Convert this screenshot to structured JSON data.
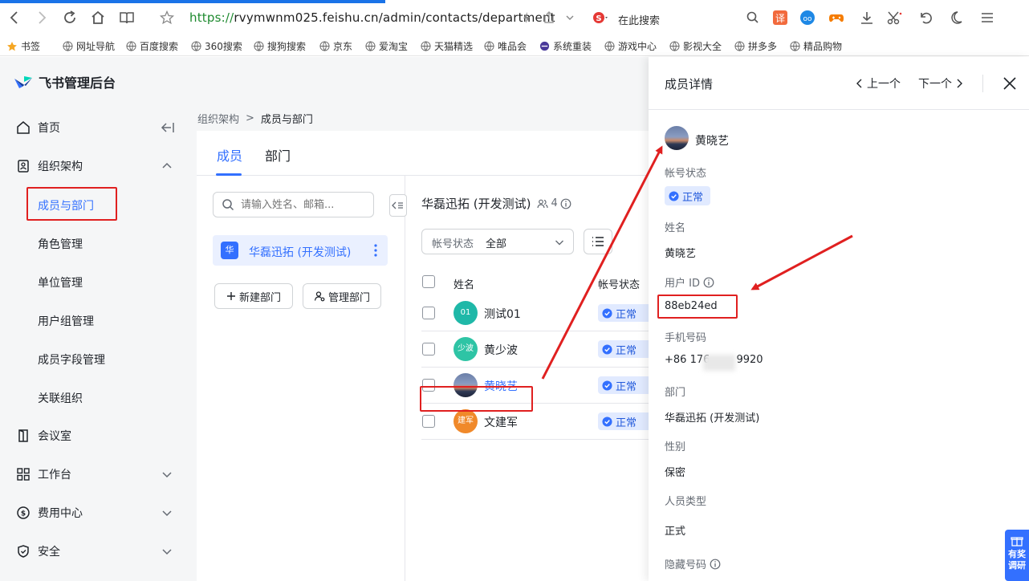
{
  "browser": {
    "url_protocol": "https://",
    "url_rest": "rvymwnm025.feishu.cn/admin/contacts/department",
    "search_placeholder": "在此搜索",
    "translate_label": "译"
  },
  "bookmarks": [
    {
      "label": "书签"
    },
    {
      "label": "网址导航"
    },
    {
      "label": "百度搜索"
    },
    {
      "label": "360搜索"
    },
    {
      "label": "搜狗搜索"
    },
    {
      "label": "京东"
    },
    {
      "label": "爱淘宝"
    },
    {
      "label": "天猫精选"
    },
    {
      "label": "唯品会"
    },
    {
      "label": "系统重装"
    },
    {
      "label": "游戏中心"
    },
    {
      "label": "影视大全"
    },
    {
      "label": "拼多多"
    },
    {
      "label": "精品购物"
    }
  ],
  "app": {
    "title": "飞书管理后台"
  },
  "sidebar": {
    "home": "首页",
    "org": "组织架构",
    "org_sub": [
      "成员与部门",
      "角色管理",
      "单位管理",
      "用户组管理",
      "成员字段管理",
      "关联组织"
    ],
    "meeting": "会议室",
    "workplace": "工作台",
    "billing": "费用中心",
    "security": "安全"
  },
  "breadcrumb": {
    "parent": "组织架构",
    "separator": ">",
    "current": "成员与部门"
  },
  "tabs": [
    {
      "label": "成员",
      "active": true
    },
    {
      "label": "部门",
      "active": false
    }
  ],
  "dept_panel": {
    "search_placeholder": "请输入姓名、邮箱...",
    "dept_badge": "华",
    "dept_name": "华磊迅拓 (开发测试)",
    "new_dept": "新建部门",
    "manage_dept": "管理部门"
  },
  "member_list": {
    "title": "华磊迅拓 (开发测试)",
    "count": "4",
    "filter_label": "帐号状态",
    "filter_value": "全部",
    "col_name": "姓名",
    "col_status": "帐号状态",
    "rows": [
      {
        "avatar": "01",
        "name": "测试01",
        "status": "正常",
        "color": "#1fb8a8"
      },
      {
        "avatar": "少波",
        "name": "黄少波",
        "status": "正常",
        "color": "#2ec4a5"
      },
      {
        "avatar": "",
        "name": "黄晓艺",
        "status": "正常",
        "color": "#4a5a7a"
      },
      {
        "avatar": "建军",
        "name": "文建军",
        "status": "正常",
        "color": "#f0892a"
      }
    ]
  },
  "detail": {
    "title": "成员详情",
    "prev": "上一个",
    "next": "下一个",
    "name_display": "黄晓艺",
    "fields": {
      "account_status_label": "帐号状态",
      "account_status": "正常",
      "name_label": "姓名",
      "name": "黄晓艺",
      "user_id_label": "用户 ID",
      "user_id": "88eb24ed",
      "phone_label": "手机号码",
      "phone": "+86 176        9920",
      "dept_label": "部门",
      "dept": "华磊迅拓 (开发测试)",
      "gender_label": "性别",
      "gender": "保密",
      "type_label": "人员类型",
      "type": "正式",
      "hidden_phone_label": "隐藏号码"
    }
  },
  "survey": {
    "label_1": "有奖",
    "label_2": "调研"
  },
  "colors": {
    "accent": "#3370ff",
    "highlight": "#e02020"
  }
}
